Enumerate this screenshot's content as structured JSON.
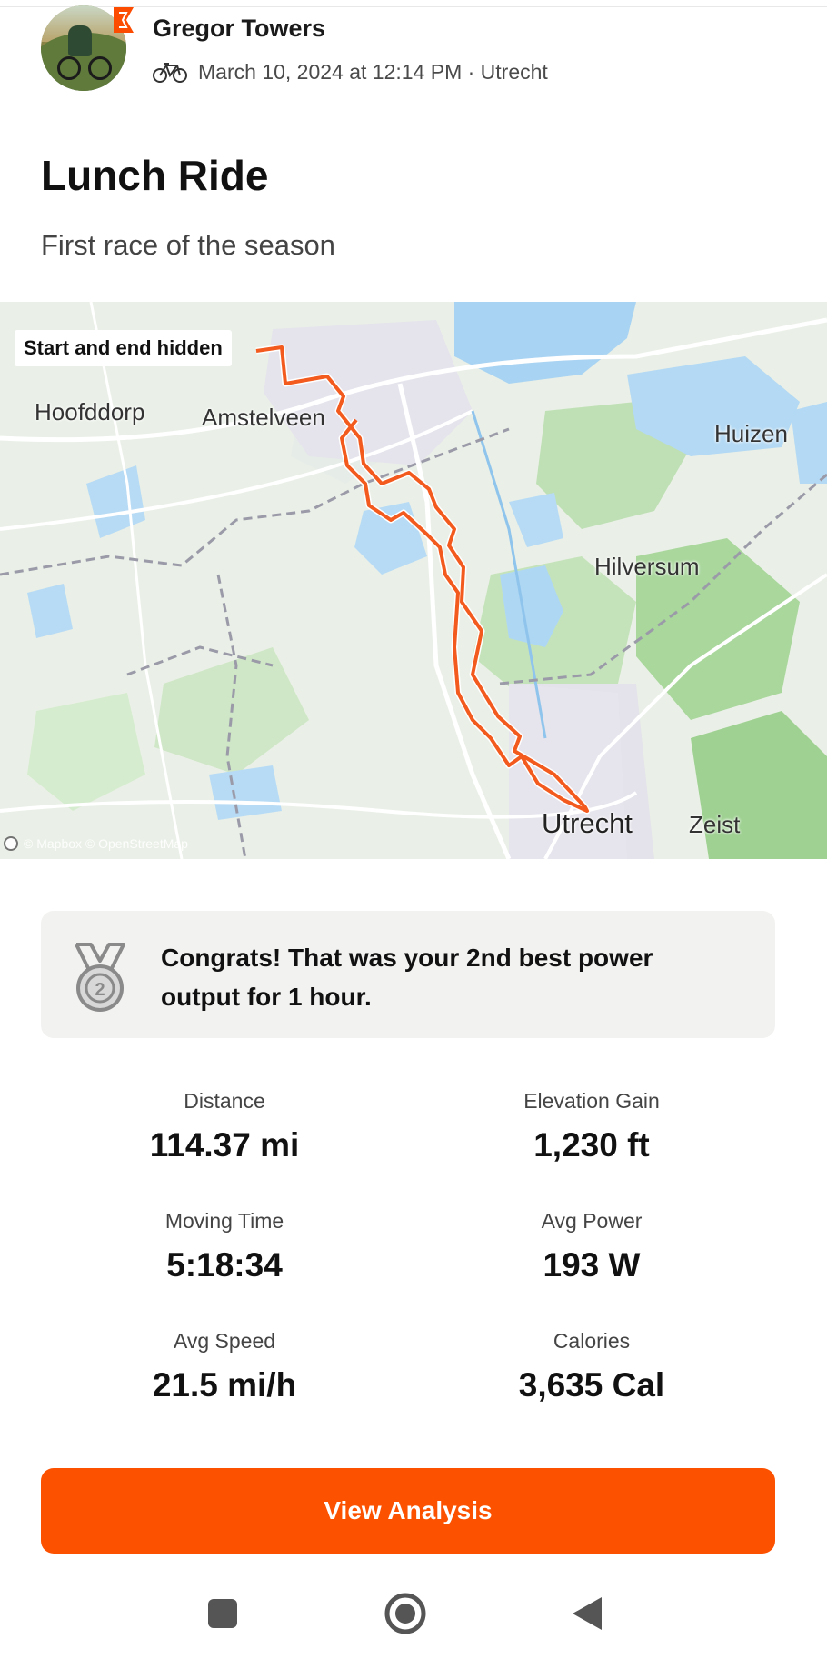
{
  "athlete": {
    "name": "Gregor Towers",
    "meta": "March 10, 2024 at 12:14 PM · Utrecht"
  },
  "activity": {
    "title": "Lunch Ride",
    "description": "First race of the season"
  },
  "map": {
    "privacy_label": "Start and end hidden",
    "places": [
      "Hoofddorp",
      "Amstelveen",
      "Huizen",
      "Hilversum",
      "Utrecht",
      "Zeist"
    ],
    "attribution": "© Mapbox © OpenStreetMap",
    "route_color": "#f25a1e"
  },
  "achievement": {
    "icon": "medal-2nd-icon",
    "text": "Congrats! That was your 2nd best power output for 1 hour."
  },
  "stats": [
    {
      "label": "Distance",
      "value": "114.37 mi"
    },
    {
      "label": "Elevation Gain",
      "value": "1,230 ft"
    },
    {
      "label": "Moving Time",
      "value": "5:18:34"
    },
    {
      "label": "Avg Power",
      "value": "193 W"
    },
    {
      "label": "Avg Speed",
      "value": "21.5 mi/h"
    },
    {
      "label": "Calories",
      "value": "3,635 Cal"
    }
  ],
  "cta": {
    "label": "View Analysis"
  },
  "colors": {
    "accent": "#fc5200",
    "card": "#f2f2f0"
  },
  "navbar": {
    "icons": [
      "recent-apps-icon",
      "home-icon",
      "back-icon"
    ]
  }
}
